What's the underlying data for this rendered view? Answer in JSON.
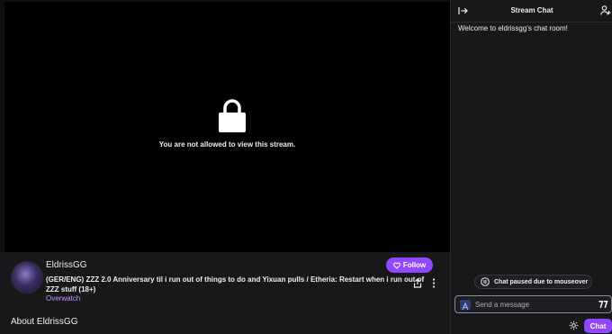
{
  "player": {
    "blocked_message": "You are not allowed to view this stream.",
    "icon": "lock-icon"
  },
  "channel": {
    "name": "EldrissGG",
    "title": "(GER/ENG) ZZZ 2.0 Anniversary til i run out of things to do and Yixuan pulls / Etheria: Restart when i run out of ZZZ stuff (18+)",
    "category": "Overwatch",
    "follow_label": "Follow",
    "about_heading": "About EldrissGG"
  },
  "chat": {
    "title": "Stream Chat",
    "welcome": "Welcome to eldrissgg's chat room!",
    "paused_notice": "Chat paused due to mouseover",
    "input_placeholder": "Send a message",
    "send_label": "Chat"
  },
  "colors": {
    "accent": "#9147ff",
    "category_link": "#bf94ff",
    "background": "#0e0e10",
    "panel": "#18181b"
  }
}
